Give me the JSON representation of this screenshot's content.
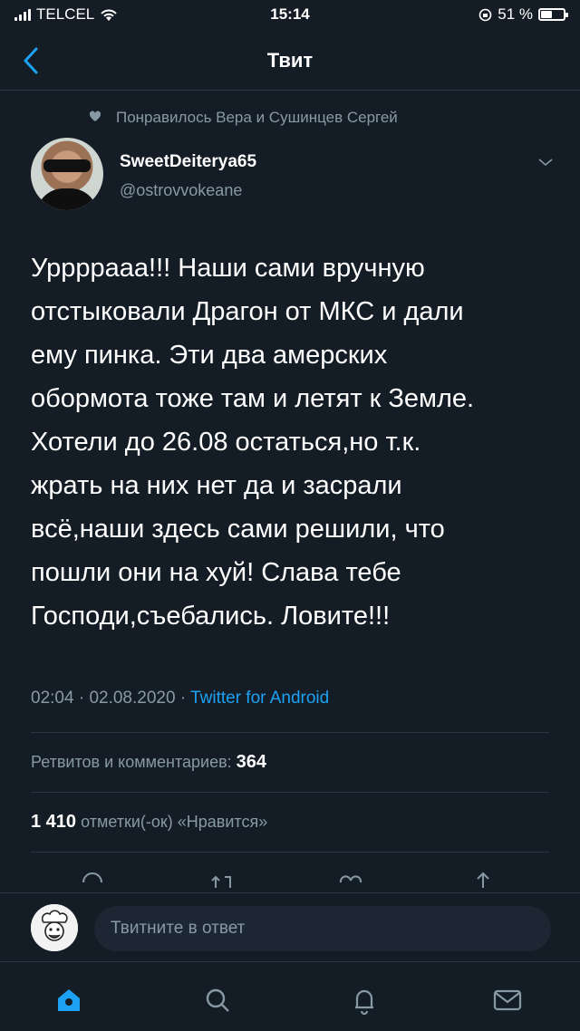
{
  "status_bar": {
    "carrier": "TELCEL",
    "time": "15:14",
    "battery": "51 %",
    "battery_level": 0.51
  },
  "nav": {
    "title": "Твит"
  },
  "liked_by": "Понравилось Вера и Сушинцев Сергей",
  "author": {
    "name": "SweetDeiterya65",
    "handle": "@ostrovvokeane"
  },
  "tweet": {
    "text": "Урррраaa!!! Наши сами вручную\nотстыковали Драгон от МКС и дали\nему пинка. Эти два амерских\nобормота тоже там и летят к Земле.\nХотели до 26.08 остаться,но т.к.\nжрать на них нет да и засрали\nвсё,наши здесь сами решили, что\nпошли они на хуй! Слава тебе\nГосподи,съебались. Ловите!!!",
    "time": "02:04",
    "date": "02.08.2020",
    "source": "Twitter for Android"
  },
  "stats": {
    "retweets_label": "Ретвитов и комментариев:",
    "retweets_count": "364",
    "likes_count": "1 410",
    "likes_label": "отметки(-ок) «Нравится»"
  },
  "reply": {
    "placeholder": "Твитните в ответ"
  },
  "icons": {
    "back": "chevron-left-icon",
    "heart": "heart-icon",
    "caret": "chevron-down-icon",
    "tabs": [
      "home-icon",
      "search-icon",
      "bell-icon",
      "mail-icon"
    ]
  },
  "colors": {
    "background": "#141d26",
    "accent": "#1da1f2",
    "muted": "#8899a6",
    "divider": "#2a3642"
  }
}
